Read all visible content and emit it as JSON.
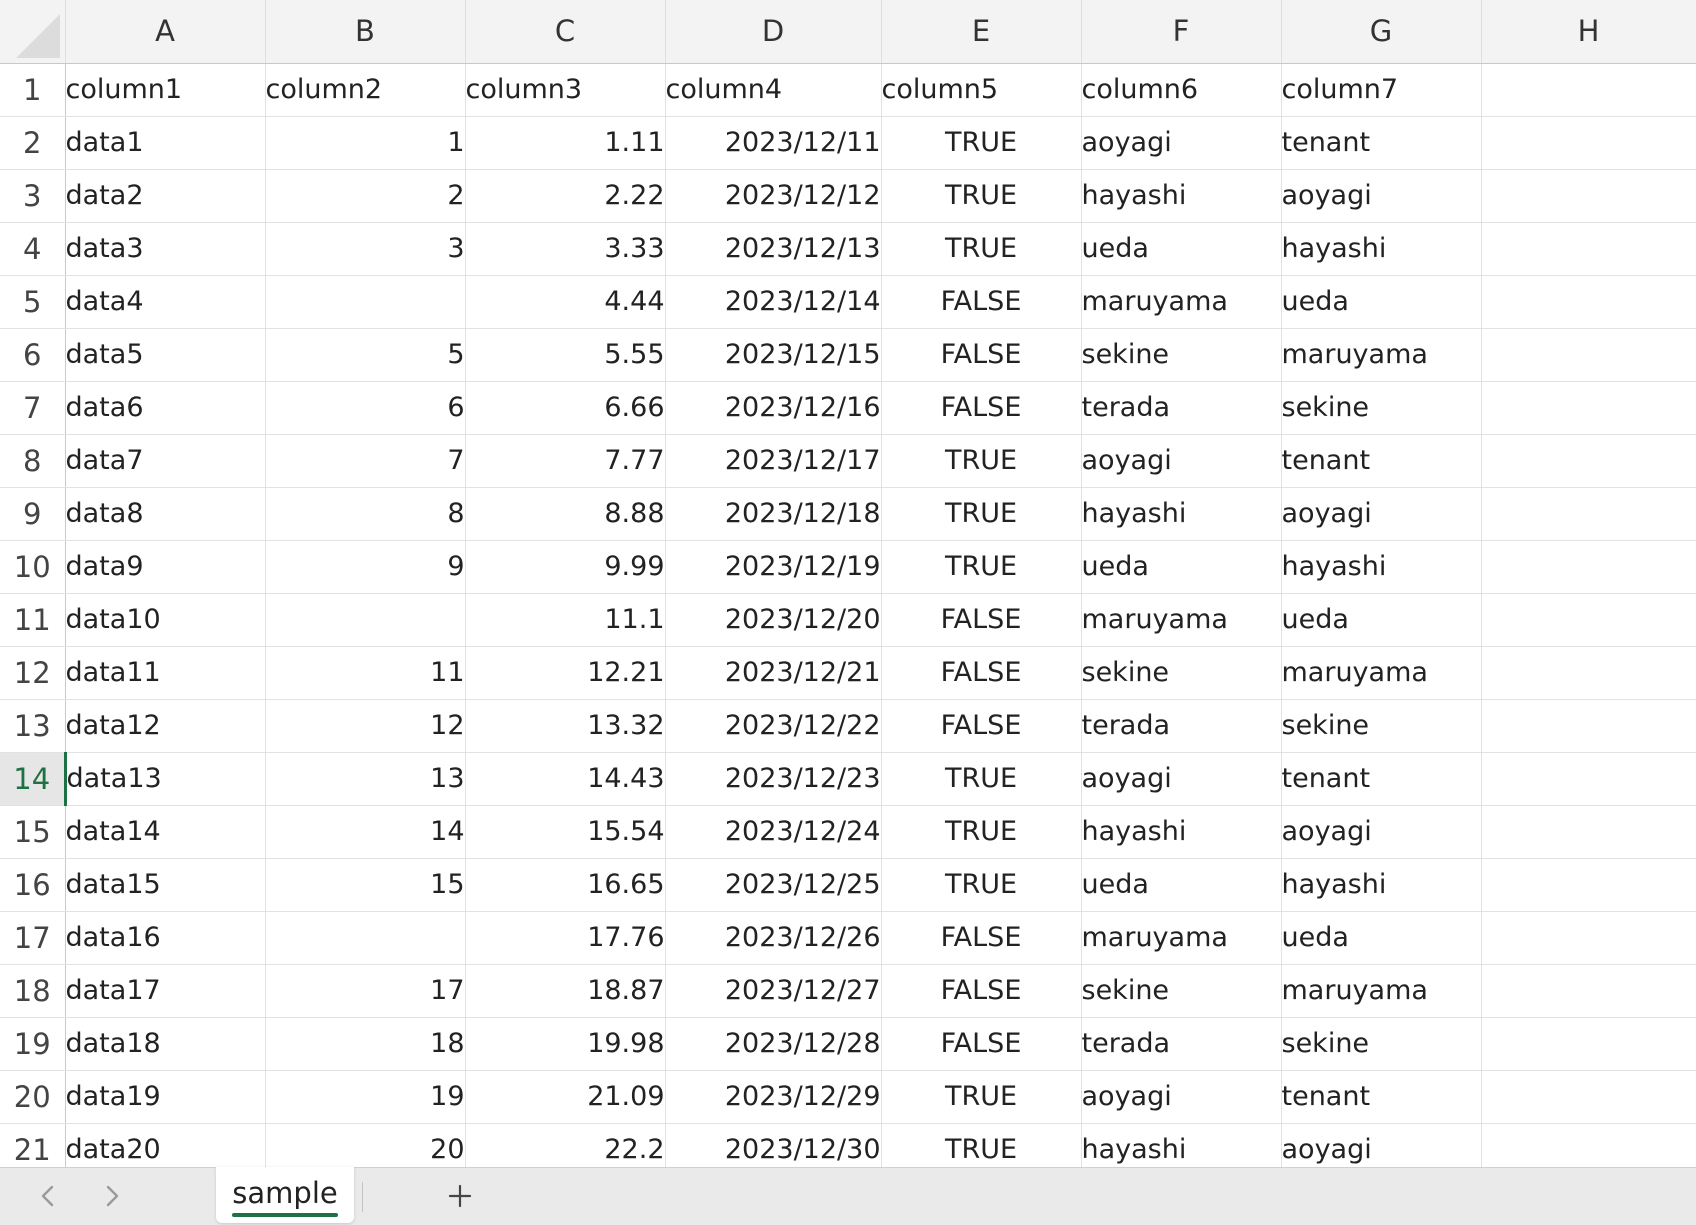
{
  "columns": [
    "A",
    "B",
    "C",
    "D",
    "E",
    "F",
    "G",
    "H"
  ],
  "active_row": 14,
  "rows": [
    {
      "n": "1",
      "cells": [
        "column1",
        "column2",
        "column3",
        "column4",
        "column5",
        "column6",
        "column7",
        ""
      ]
    },
    {
      "n": "2",
      "cells": [
        "data1",
        "1",
        "1.11",
        "2023/12/11",
        "TRUE",
        "aoyagi",
        "tenant",
        ""
      ]
    },
    {
      "n": "3",
      "cells": [
        "data2",
        "2",
        "2.22",
        "2023/12/12",
        "TRUE",
        "hayashi",
        "aoyagi",
        ""
      ]
    },
    {
      "n": "4",
      "cells": [
        "data3",
        "3",
        "3.33",
        "2023/12/13",
        "TRUE",
        "ueda",
        "hayashi",
        ""
      ]
    },
    {
      "n": "5",
      "cells": [
        "data4",
        "",
        "4.44",
        "2023/12/14",
        "FALSE",
        "maruyama",
        "ueda",
        ""
      ]
    },
    {
      "n": "6",
      "cells": [
        "data5",
        "5",
        "5.55",
        "2023/12/15",
        "FALSE",
        "sekine",
        "maruyama",
        ""
      ]
    },
    {
      "n": "7",
      "cells": [
        "data6",
        "6",
        "6.66",
        "2023/12/16",
        "FALSE",
        "terada",
        "sekine",
        ""
      ]
    },
    {
      "n": "8",
      "cells": [
        "data7",
        "7",
        "7.77",
        "2023/12/17",
        "TRUE",
        "aoyagi",
        "tenant",
        ""
      ]
    },
    {
      "n": "9",
      "cells": [
        "data8",
        "8",
        "8.88",
        "2023/12/18",
        "TRUE",
        "hayashi",
        "aoyagi",
        ""
      ]
    },
    {
      "n": "10",
      "cells": [
        "data9",
        "9",
        "9.99",
        "2023/12/19",
        "TRUE",
        "ueda",
        "hayashi",
        ""
      ]
    },
    {
      "n": "11",
      "cells": [
        "data10",
        "",
        "11.1",
        "2023/12/20",
        "FALSE",
        "maruyama",
        "ueda",
        ""
      ]
    },
    {
      "n": "12",
      "cells": [
        "data11",
        "11",
        "12.21",
        "2023/12/21",
        "FALSE",
        "sekine",
        "maruyama",
        ""
      ]
    },
    {
      "n": "13",
      "cells": [
        "data12",
        "12",
        "13.32",
        "2023/12/22",
        "FALSE",
        "terada",
        "sekine",
        ""
      ]
    },
    {
      "n": "14",
      "cells": [
        "data13",
        "13",
        "14.43",
        "2023/12/23",
        "TRUE",
        "aoyagi",
        "tenant",
        ""
      ]
    },
    {
      "n": "15",
      "cells": [
        "data14",
        "14",
        "15.54",
        "2023/12/24",
        "TRUE",
        "hayashi",
        "aoyagi",
        ""
      ]
    },
    {
      "n": "16",
      "cells": [
        "data15",
        "15",
        "16.65",
        "2023/12/25",
        "TRUE",
        "ueda",
        "hayashi",
        ""
      ]
    },
    {
      "n": "17",
      "cells": [
        "data16",
        "",
        "17.76",
        "2023/12/26",
        "FALSE",
        "maruyama",
        "ueda",
        ""
      ]
    },
    {
      "n": "18",
      "cells": [
        "data17",
        "17",
        "18.87",
        "2023/12/27",
        "FALSE",
        "sekine",
        "maruyama",
        ""
      ]
    },
    {
      "n": "19",
      "cells": [
        "data18",
        "18",
        "19.98",
        "2023/12/28",
        "FALSE",
        "terada",
        "sekine",
        ""
      ]
    },
    {
      "n": "20",
      "cells": [
        "data19",
        "19",
        "21.09",
        "2023/12/29",
        "TRUE",
        "aoyagi",
        "tenant",
        ""
      ]
    },
    {
      "n": "21",
      "cells": [
        "data20",
        "20",
        "22.2",
        "2023/12/30",
        "TRUE",
        "hayashi",
        "aoyagi",
        ""
      ]
    }
  ],
  "tabs": {
    "sheet_name": "sample",
    "prev_icon": "chevron-left-icon",
    "next_icon": "chevron-right-icon",
    "add_icon": "plus-icon",
    "accent_color": "#1e7145"
  }
}
